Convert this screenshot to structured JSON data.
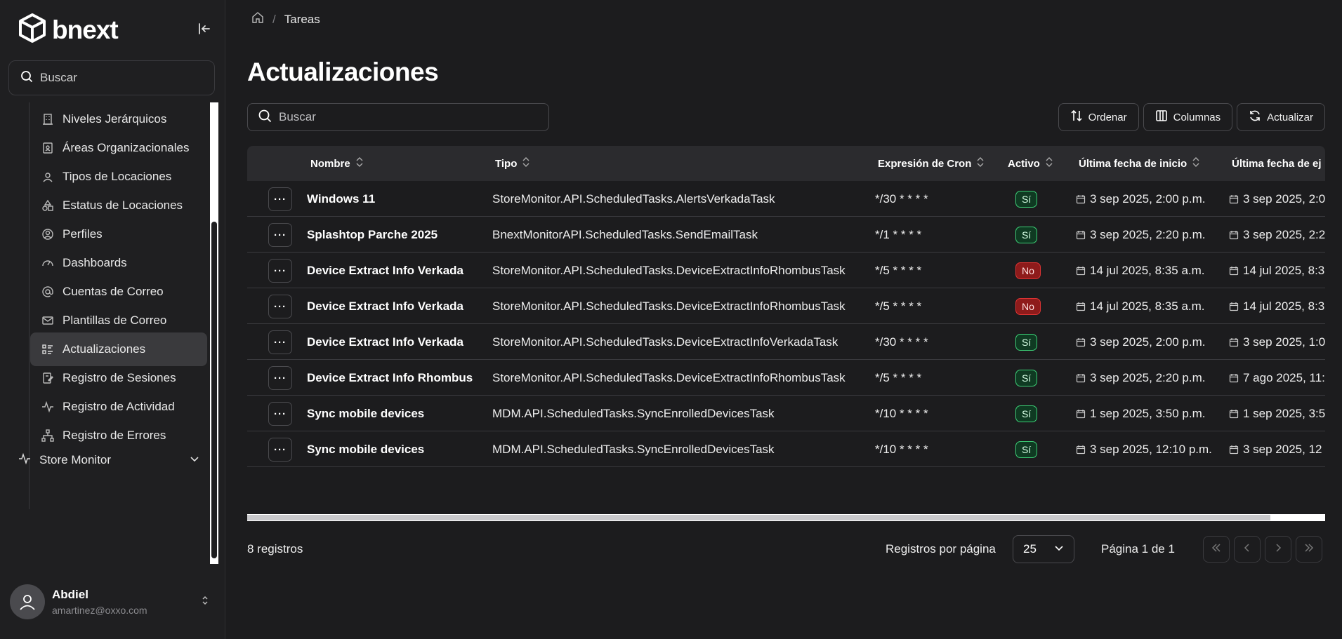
{
  "brand": {
    "name": "bnext"
  },
  "sidebar": {
    "search_placeholder": "Buscar",
    "items": [
      {
        "label": "Niveles Jerárquicos",
        "icon": "building-icon"
      },
      {
        "label": "Áreas Organizacionales",
        "icon": "contact-book-icon"
      },
      {
        "label": "Tipos de Locaciones",
        "icon": "map-pin-user-icon"
      },
      {
        "label": "Estatus de Locaciones",
        "icon": "status-shapes-icon"
      },
      {
        "label": "Perfiles",
        "icon": "user-circle-icon"
      },
      {
        "label": "Dashboards",
        "icon": "gauge-icon"
      },
      {
        "label": "Cuentas de Correo",
        "icon": "at-sign-icon"
      },
      {
        "label": "Plantillas de Correo",
        "icon": "mail-icon"
      },
      {
        "label": "Actualizaciones",
        "icon": "list-icon",
        "active": true
      },
      {
        "label": "Registro de Sesiones",
        "icon": "edit-log-icon"
      },
      {
        "label": "Registro de Actividad",
        "icon": "activity-icon"
      },
      {
        "label": "Registro de Errores",
        "icon": "network-icon"
      }
    ],
    "store_monitor": {
      "label": "Store Monitor"
    },
    "user": {
      "name": "Abdiel",
      "email": "amartinez@oxxo.com"
    }
  },
  "breadcrumb": {
    "current": "Tareas"
  },
  "page": {
    "title": "Actualizaciones"
  },
  "table": {
    "search_placeholder": "Buscar",
    "toolbar": {
      "sort": "Ordenar",
      "columns": "Columnas",
      "refresh": "Actualizar"
    },
    "columns": {
      "name": "Nombre",
      "type": "Tipo",
      "cron": "Expresión de Cron",
      "active": "Activo",
      "last_start": "Última fecha de inicio",
      "last_exec": "Última fecha de ej"
    },
    "rows": [
      {
        "name": "Windows 11",
        "type": "StoreMonitor.API.ScheduledTasks.AlertsVerkadaTask",
        "cron": "*/30 * * * *",
        "active": "Sí",
        "active_state": "yes",
        "last_start": "3 sep 2025, 2:00 p.m.",
        "last_exec": "3 sep 2025, 2:0"
      },
      {
        "name": "Splashtop Parche 2025",
        "type": "BnextMonitorAPI.ScheduledTasks.SendEmailTask",
        "cron": "*/1 * * * *",
        "active": "Sí",
        "active_state": "yes",
        "last_start": "3 sep 2025, 2:20 p.m.",
        "last_exec": "3 sep 2025, 2:2"
      },
      {
        "name": "Device Extract Info Verkada",
        "type": "StoreMonitor.API.ScheduledTasks.DeviceExtractInfoRhombusTask",
        "cron": "*/5 * * * *",
        "active": "No",
        "active_state": "no",
        "last_start": "14 jul 2025, 8:35 a.m.",
        "last_exec": "14 jul 2025, 8:3"
      },
      {
        "name": "Device Extract Info Verkada",
        "type": "StoreMonitor.API.ScheduledTasks.DeviceExtractInfoRhombusTask",
        "cron": "*/5 * * * *",
        "active": "No",
        "active_state": "no",
        "last_start": "14 jul 2025, 8:35 a.m.",
        "last_exec": "14 jul 2025, 8:3"
      },
      {
        "name": "Device Extract Info Verkada",
        "type": "StoreMonitor.API.ScheduledTasks.DeviceExtractInfoVerkadaTask",
        "cron": "*/30 * * * *",
        "active": "Sí",
        "active_state": "yes",
        "last_start": "3 sep 2025, 2:00 p.m.",
        "last_exec": "3 sep 2025, 1:0"
      },
      {
        "name": "Device Extract Info Rhombus",
        "type": "StoreMonitor.API.ScheduledTasks.DeviceExtractInfoRhombusTask",
        "cron": "*/5 * * * *",
        "active": "Sí",
        "active_state": "yes",
        "last_start": "3 sep 2025, 2:20 p.m.",
        "last_exec": "7 ago 2025, 11:"
      },
      {
        "name": "Sync mobile devices",
        "type": "MDM.API.ScheduledTasks.SyncEnrolledDevicesTask",
        "cron": "*/10 * * * *",
        "active": "Sí",
        "active_state": "yes",
        "last_start": "1 sep 2025, 3:50 p.m.",
        "last_exec": "1 sep 2025, 3:5"
      },
      {
        "name": "Sync mobile devices",
        "type": "MDM.API.ScheduledTasks.SyncEnrolledDevicesTask",
        "cron": "*/10 * * * *",
        "active": "Sí",
        "active_state": "yes",
        "last_start": "3 sep 2025, 12:10 p.m.",
        "last_exec": "3 sep 2025, 12"
      }
    ],
    "row_action_label": "···"
  },
  "footer": {
    "count": "8 registros",
    "per_page_label": "Registros por página",
    "per_page_value": "25",
    "page_info": "Página 1 de 1"
  },
  "colors": {
    "background": "#1c1c1e",
    "badge_yes": "#3ccf76",
    "badge_no": "#8e1b1b"
  }
}
